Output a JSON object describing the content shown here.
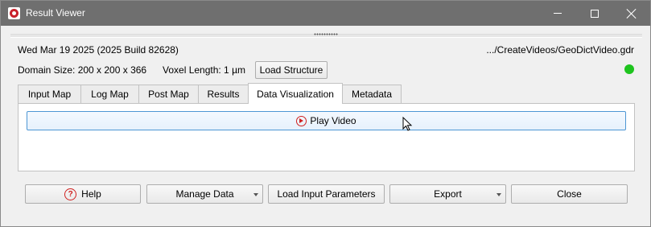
{
  "window": {
    "title": "Result Viewer"
  },
  "info": {
    "build": "Wed Mar 19 2025 (2025 Build 82628)",
    "path": ".../CreateVideos/GeoDictVideo.gdr",
    "domain_size": "Domain Size: 200 x 200 x 366",
    "voxel_length": "Voxel Length: 1 µm",
    "load_structure_label": "Load Structure",
    "status_color": "#1ec41e"
  },
  "tabs": [
    {
      "label": "Input Map",
      "active": false
    },
    {
      "label": "Log Map",
      "active": false
    },
    {
      "label": "Post Map",
      "active": false
    },
    {
      "label": "Results",
      "active": false
    },
    {
      "label": "Data Visualization",
      "active": true
    },
    {
      "label": "Metadata",
      "active": false
    }
  ],
  "panel": {
    "play_video_label": "Play Video",
    "play_icon": "play-circle-icon"
  },
  "footer": {
    "help_label": "Help",
    "manage_data_label": "Manage Data",
    "load_input_parameters_label": "Load Input Parameters",
    "export_label": "Export",
    "close_label": "Close"
  },
  "colors": {
    "titlebar": "#6f6f6f",
    "accent_red": "#d0201f",
    "focus_blue": "#4e97d4"
  }
}
